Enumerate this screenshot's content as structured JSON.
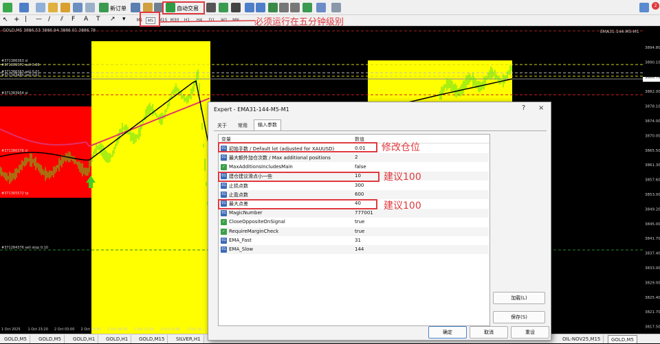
{
  "toolbar": {
    "new_order": "新订单",
    "auto_trading": "自动交易",
    "notif_badge": "2"
  },
  "timeframes": [
    "M1",
    "M5",
    "M15",
    "M30",
    "H1",
    "H4",
    "D1",
    "W1",
    "MN"
  ],
  "annotation_top": "必须运行在五分钟级别",
  "chart": {
    "symbol_line": "GOLD,M5 3886.53 3886.94 3886.01 3886.78",
    "indicator_label": "EMA31-144-M5-M1",
    "price_levels": [
      "3894.80",
      "3890.10",
      "3886.78",
      "3882.00",
      "3878.10",
      "3874.00",
      "3870.00",
      "3865.50",
      "3861.30",
      "3857.60",
      "3853.00",
      "3849.20",
      "3845.00",
      "3841.70",
      "3837.40",
      "3833.00",
      "3829.00",
      "3825.40",
      "3821.70",
      "3817.50"
    ],
    "time_labels": [
      "1 Oct 2025",
      "1 Oct 23:20",
      "2 Oct 03:00",
      "2 Oct 05:40",
      "2 Oct 08:20",
      "2 Oct 11:00",
      "2 Oct 13:40",
      "2 Oct 16:..."
    ],
    "order_labels": [
      "#371386363 sl",
      "#371385572 sell 0.06",
      "#371386363 sell 0.01",
      "#371383885 sell 0.01",
      "#371383954 sl",
      "#371386376 sl",
      "#371365572 tp",
      "#371284376 sell stop 0.10"
    ]
  },
  "dialog": {
    "title": "Expert - EMA31-144-M5-M1",
    "help": "?",
    "close": "×",
    "tabs": [
      "关于",
      "常用",
      "输入参数"
    ],
    "headers": {
      "variable": "变量",
      "value": "数值"
    },
    "params": [
      {
        "name": "初始手数 / Default lot (adjusted for XAUUSD)",
        "value": "0.01",
        "type": "num"
      },
      {
        "name": "最大额外加仓次数 / Max additional positions",
        "value": "2",
        "type": "num"
      },
      {
        "name": "MaxAdditionsIncludesMain",
        "value": "false",
        "type": "bool"
      },
      {
        "name": "建仓建议滑点小一些",
        "value": "10",
        "type": "num"
      },
      {
        "name": "止损点数",
        "value": "300",
        "type": "num"
      },
      {
        "name": "止盈点数",
        "value": "600",
        "type": "num"
      },
      {
        "name": "最大点差",
        "value": "40",
        "type": "num"
      },
      {
        "name": "MagicNumber",
        "value": "777001",
        "type": "num"
      },
      {
        "name": "CloseOppositeOnSignal",
        "value": "true",
        "type": "bool"
      },
      {
        "name": "RequireMarginCheck",
        "value": "true",
        "type": "bool"
      },
      {
        "name": "EMA_Fast",
        "value": "31",
        "type": "num"
      },
      {
        "name": "EMA_Slow",
        "value": "144",
        "type": "num"
      }
    ],
    "load_button": "加载(L)",
    "save_button": "保存(S)",
    "ok_button": "确定",
    "cancel_button": "取消",
    "reset_button": "重设"
  },
  "annotations": {
    "lot": "修改仓位",
    "slip": "建议100",
    "spread": "建议100"
  },
  "bottom_tabs": [
    "GOLD,M5",
    "GOLD,M5",
    "GOLD,H1",
    "GOLD,H1",
    "GOLD,M15",
    "SILVER,H1",
    "OIL-NOV25,M15",
    "GOLD,M5"
  ],
  "colors": {
    "accent_red": "#e0393e",
    "zone_yellow": "#ffff00",
    "zone_red": "#ff0000",
    "candle_green": "#55dd22",
    "ema_fast": "#000000",
    "ema_slow": "#e0306a"
  }
}
